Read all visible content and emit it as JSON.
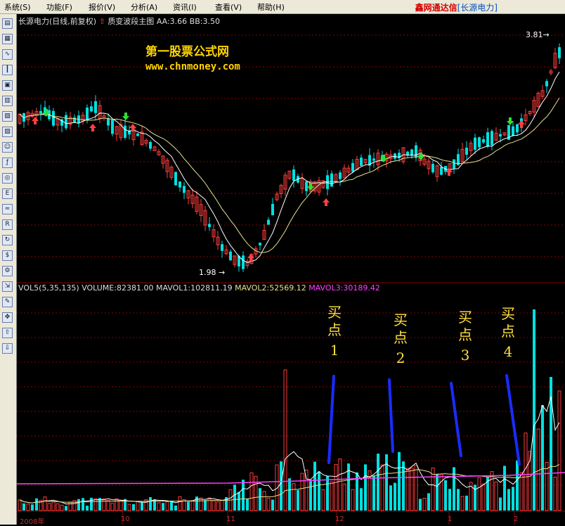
{
  "menu": {
    "items": [
      "系统(S)",
      "功能(F)",
      "报价(V)",
      "分析(A)",
      "资讯(I)",
      "查看(V)",
      "帮助(H)"
    ],
    "app_title": "鑫网通达信",
    "app_subtitle": "[长源电力]"
  },
  "chart": {
    "stock_title": "长源电力(日线,前复权)",
    "indicator_name": "质变波段主图",
    "indicator_values": "AA:3.66  BB:3.50",
    "high_label": "3.81",
    "low_label": "1.98",
    "watermark_line1": "第一股票公式网",
    "watermark_line2": "www.chnmoney.com"
  },
  "volume_panel": {
    "formula": "VOL5(5,35,135)",
    "volume": "VOLUME:82381.00",
    "mavol1": "MAVOL1:102811.19",
    "mavol2": "MAVOL2:52569.12",
    "mavol3": "MAVOL3:30189.42"
  },
  "buy_points": [
    {
      "top": "买",
      "mid": "点",
      "num": "1"
    },
    {
      "top": "买",
      "mid": "点",
      "num": "2"
    },
    {
      "top": "买",
      "mid": "点",
      "num": "3"
    },
    {
      "top": "买",
      "mid": "点",
      "num": "4"
    }
  ],
  "date_axis": [
    "2008年",
    "10",
    "11",
    "12",
    "1",
    "2"
  ],
  "colors": {
    "up": "#ff3c3c",
    "down": "#00e0e0",
    "ma_short": "#ffffff",
    "ma_long": "#e8e090",
    "mavol3": "#ff40ff",
    "buy_line": "#1a2cff",
    "grid": "#8b0000"
  },
  "toolbar_icons": [
    "quote-icon",
    "list-icon",
    "line-chart-icon",
    "kline-icon",
    "news-icon",
    "table-icon",
    "board-icon",
    "calc-icon",
    "users-icon",
    "fx-icon",
    "zoom-icon",
    "etf-icon",
    "trend-icon",
    "rsi-icon",
    "refresh-icon",
    "money-icon",
    "tools-icon",
    "export-icon",
    "pencil-icon",
    "move-icon",
    "up-arrow-icon",
    "down-arrow-icon"
  ]
}
